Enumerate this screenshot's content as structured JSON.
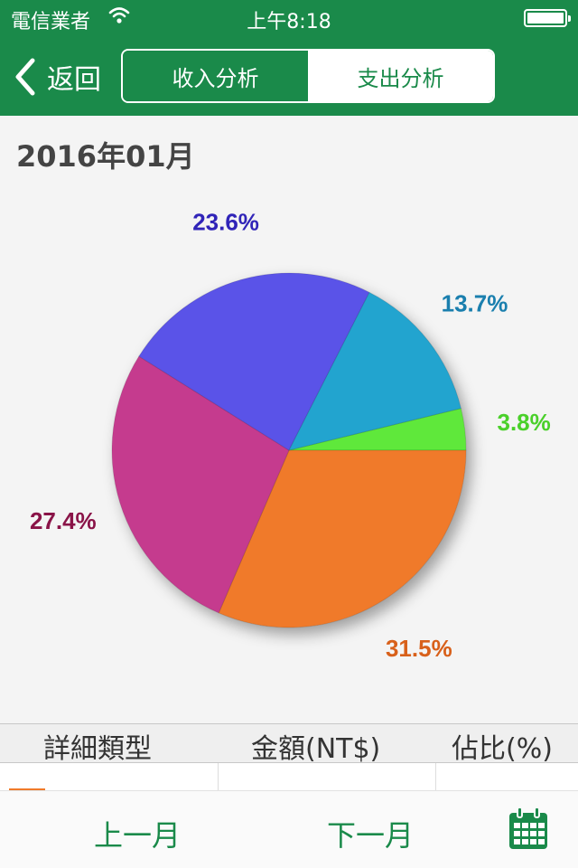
{
  "status_bar": {
    "carrier": "電信業者",
    "time": "上午8:18"
  },
  "nav": {
    "back_label": "返回",
    "segments": [
      "收入分析",
      "支出分析"
    ],
    "active_segment": 0
  },
  "month_title": "2016年01月",
  "colors": {
    "brand": "#1a8a4a"
  },
  "chart_data": {
    "type": "pie",
    "title": "",
    "slices": [
      {
        "value": 3.8,
        "label": "3.8%",
        "color": "#5ee83a",
        "label_color": "#4ad02a"
      },
      {
        "value": 31.5,
        "label": "31.5%",
        "color": "#f07a2a",
        "label_color": "#d8601a"
      },
      {
        "value": 27.4,
        "label": "27.4%",
        "color": "#c53a8e",
        "label_color": "#8a1448"
      },
      {
        "value": 23.6,
        "label": "23.6%",
        "color": "#5a52e8",
        "label_color": "#3024b8"
      },
      {
        "value": 13.7,
        "label": "13.7%",
        "color": "#22a4cf",
        "label_color": "#1a7fae"
      }
    ]
  },
  "table": {
    "headers": [
      "詳細類型",
      "金額(NT$)",
      "佔比(%)"
    ]
  },
  "bottom_bar": {
    "prev_label": "上一月",
    "next_label": "下一月",
    "calendar_icon": "calendar-icon"
  }
}
